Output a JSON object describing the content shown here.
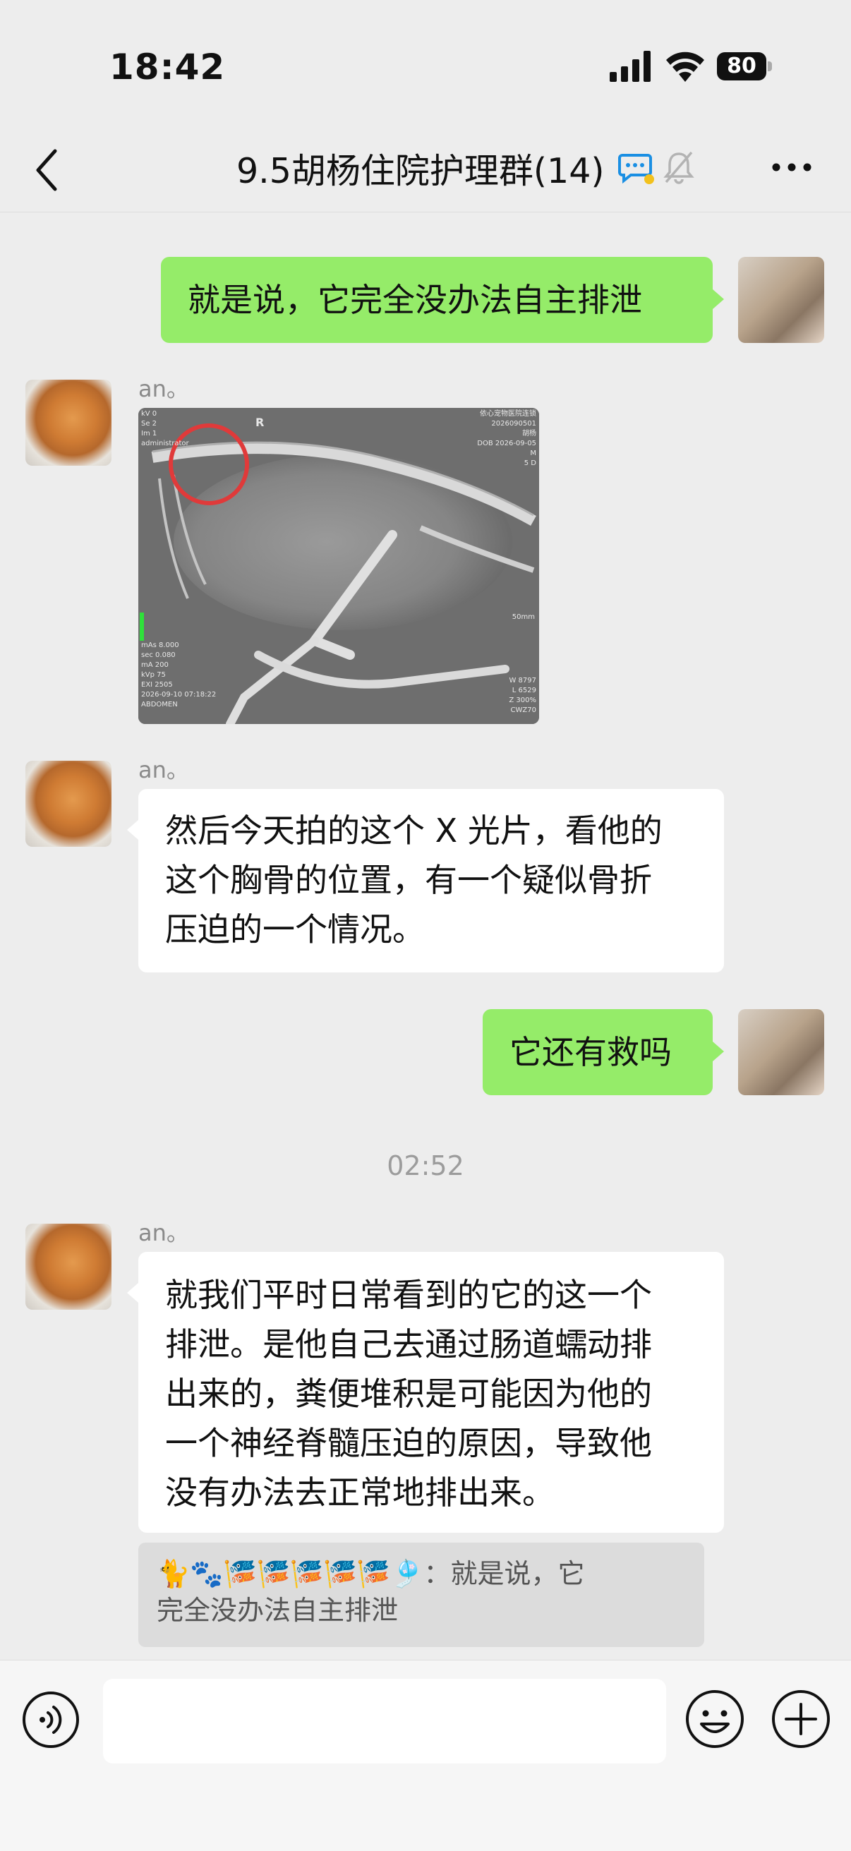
{
  "status_bar": {
    "time": "18:42",
    "battery": "80"
  },
  "nav": {
    "back_label": "<",
    "title": "9.5胡杨住院护理群(14)"
  },
  "messages": [
    {
      "side": "self",
      "text": "就是说，它完全没办法自主排泄"
    },
    {
      "side": "other",
      "sender": "an。",
      "type": "image",
      "image_desc_label": "X光片"
    },
    {
      "side": "other",
      "sender": "an。",
      "lines": [
        "然后今天拍的这个 X 光片，看他的",
        "这个胸骨的位置，有一个疑似骨折",
        "压迫的一个情况。"
      ]
    },
    {
      "side": "self",
      "text": "它还有救吗"
    },
    {
      "timestamp": "02:52"
    },
    {
      "side": "other",
      "sender": "an。",
      "lines": [
        "就我们平时日常看到的它的这一个",
        "排泄。是他自己去通过肠道蠕动排",
        "出来的，粪便堆积是可能因为他的",
        "一个神经脊髓压迫的原因，导致他",
        "没有办法去正常地排出来。"
      ]
    }
  ],
  "quote": {
    "prefix": "🐈🐾🎏🎏🎏🎏🎏🎐：",
    "line1": "就是说，它",
    "line2": "完全没办法自主排泄"
  },
  "xray_labels": {
    "left_top": "kV 0\nSe 2\nIm 1\nadministrator",
    "right_top": "依心宠物医院连锁\n2026090501\n胡杨\nDOB 2026-09-05\nM\n5 D",
    "marker": "R",
    "scale": "50mm",
    "left_bottom": "mAs 8.000\nsec 0.080\nmA 200\nkVp 75\nEXI 2505\n2026-09-10 07:18:22\nABDOMEN",
    "right_bottom": "W 8797\nL 6529\nZ 300%\nCWZ70"
  },
  "colors": {
    "green_bubble": "#95ec69",
    "background": "#ededed"
  }
}
